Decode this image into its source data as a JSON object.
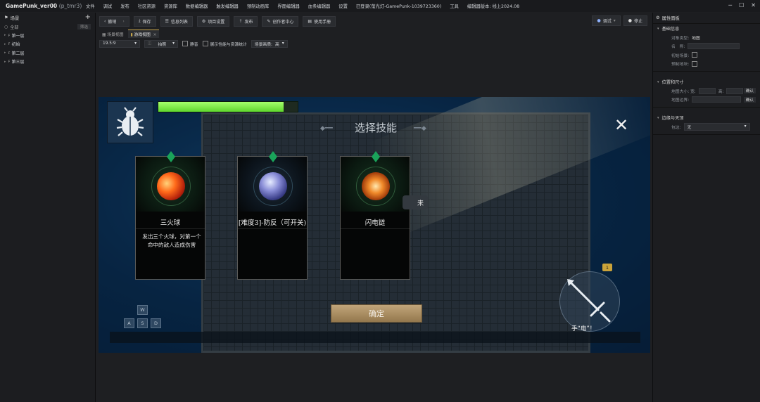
{
  "titlebar": {
    "app_name": "GamePunk_ver00",
    "project": "(p_tmr3)",
    "menu": [
      "文件",
      "调试",
      "发布",
      "社区资源",
      "资源库",
      "数据编辑器",
      "触发编辑器",
      "预制动画库",
      "界面编辑器",
      "血条编辑器",
      "设置",
      "已登录(萤光灯-GamePunk-1039723360)",
      "工具",
      "编辑器版本: 线上2024.08"
    ]
  },
  "left_panel": {
    "title": "场景",
    "search_placeholder": "全部",
    "filter_label": "筛选",
    "tree": [
      "第一层",
      "初始",
      "第二层",
      "第三层"
    ],
    "tree_prefix": "ꜰ"
  },
  "toolbar": {
    "undo": "撤销",
    "save": "保存",
    "info_list": "信息列表",
    "project_settings": "项目设置",
    "publish": "发布",
    "creator_center": "创作者中心",
    "manual": "使用手册",
    "debug": "调试",
    "stop": "停止"
  },
  "tabs": {
    "scene_view": "场景视图",
    "game_view": "游戏视图"
  },
  "subbar": {
    "aspect": "19.5:9",
    "mode": "拍照",
    "mute": "静音",
    "show_stats": "展示性能与资源统计",
    "quality_label": "场景画质:",
    "quality_value": "高"
  },
  "game": {
    "dialog_title": "选择技能",
    "health_fraction": 0.9,
    "cards": [
      {
        "name": "三火球",
        "desc": "发出三个火球，对第一个命中的敌人造成伤害"
      },
      {
        "name": "[难度3]-防反（可开关)",
        "desc": ""
      },
      {
        "name": "闪电链",
        "desc": ""
      }
    ],
    "hidden_button_text": "来",
    "confirm": "确定",
    "keys": {
      "w": "W",
      "a": "A",
      "s": "S",
      "d": "D"
    },
    "skill_badge": "1",
    "skill_label": "手“电”！"
  },
  "right_panel": {
    "title": "属性面板",
    "basic_section": "基础信息",
    "object_type_label": "对象类型:",
    "object_type_value": "地图",
    "name_label": "名　称:",
    "initial_scene_label": "初始场景:",
    "preset_label": "预制地块:",
    "size_section": "位置和尺寸",
    "map_size_label": "地图大小: 宽:",
    "height_label": "高:",
    "map_border_label": "地图边界:",
    "confirm_btn": "确认",
    "edge_section": "边缘与天顶",
    "wrap_label": "包边:",
    "wrap_value": "无"
  },
  "colors": {
    "accent_gold": "#c8a64a",
    "health_green": "#7ee24a",
    "confirm_button": "#b09464",
    "background": "#1e1f22"
  }
}
